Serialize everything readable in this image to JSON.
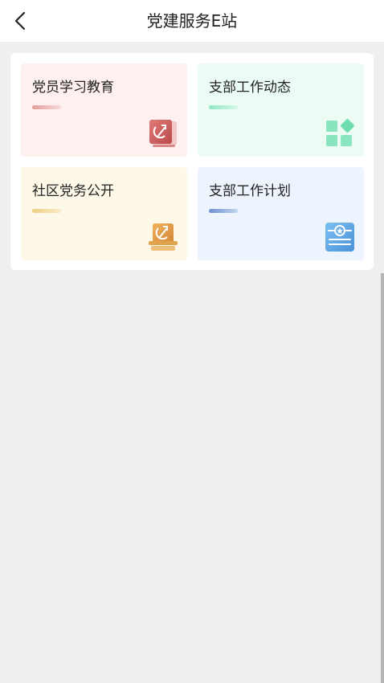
{
  "header": {
    "title": "党建服务E站",
    "back_icon": "chevron-left-icon"
  },
  "tiles": [
    {
      "label": "党员学习教育",
      "icon": "party-book-icon",
      "accent": "#d96b6b",
      "background": "#fdf0ee"
    },
    {
      "label": "支部工作动态",
      "icon": "app-grid-icon",
      "accent": "#7fe0b6",
      "background": "#ecfcf5"
    },
    {
      "label": "社区党务公开",
      "icon": "party-podium-icon",
      "accent": "#e2a24c",
      "background": "#fdf8e8"
    },
    {
      "label": "支部工作计划",
      "icon": "document-star-icon",
      "accent": "#5f9fe0",
      "background": "#edf4fd"
    }
  ]
}
